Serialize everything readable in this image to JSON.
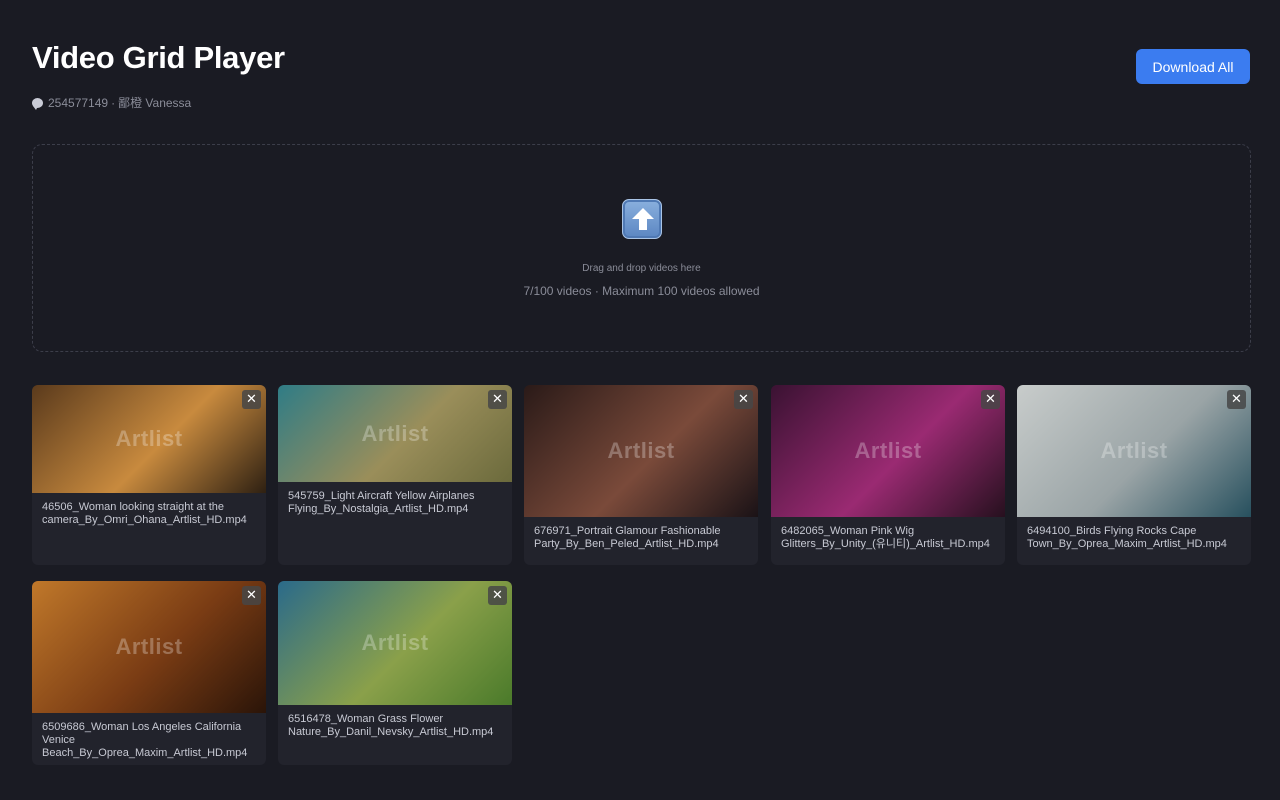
{
  "header": {
    "title": "Video Grid Player",
    "subtitle_id": "254577149",
    "subtitle_sep": "·",
    "subtitle_name": "鄙橙 Vanessa",
    "download_label": "Download All"
  },
  "dropzone": {
    "icon": "upload-arrow-icon",
    "text": "Drag and drop videos here",
    "count": "7/100 videos · Maximum 100 videos allowed"
  },
  "videos": [
    {
      "name": "46506_Woman looking straight at the camera_By_Omri_Ohana_Artlist_HD.mp4",
      "watermark": "Artlist",
      "close": "✕",
      "colors": [
        "#5a3a1c",
        "#c88a3e",
        "#2e2012"
      ]
    },
    {
      "name": "545759_Light Aircraft Yellow Airplanes Flying_By_Nostalgia_Artlist_HD.mp4",
      "watermark": "Artlist",
      "close": "✕",
      "colors": [
        "#2f7c86",
        "#9a8e5a",
        "#6b6a3c"
      ]
    },
    {
      "name": "676971_Portrait Glamour Fashionable Party_By_Ben_Peled_Artlist_HD.mp4",
      "watermark": "Artlist",
      "close": "✕",
      "colors": [
        "#2a1a18",
        "#7a4a3a",
        "#1a1216"
      ]
    },
    {
      "name": "6482065_Woman Pink Wig Glitters_By_Unity_(유니티)_Artlist_HD.mp4",
      "watermark": "Artlist",
      "close": "✕",
      "colors": [
        "#3a1232",
        "#9a2a72",
        "#26101e"
      ]
    },
    {
      "name": "6494100_Birds Flying Rocks Cape Town_By_Oprea_Maxim_Artlist_HD.mp4",
      "watermark": "Artlist",
      "close": "✕",
      "colors": [
        "#c8cccb",
        "#9aa4a6",
        "#27505e"
      ]
    },
    {
      "name": "6509686_Woman Los Angeles California Venice Beach_By_Oprea_Maxim_Artlist_HD.mp4",
      "watermark": "Artlist",
      "close": "✕",
      "colors": [
        "#c0782a",
        "#7a3c14",
        "#2a1408"
      ]
    },
    {
      "name": "6516478_Woman Grass Flower Nature_By_Danil_Nevsky_Artlist_HD.mp4",
      "watermark": "Artlist",
      "close": "✕",
      "colors": [
        "#2a6a8a",
        "#8aa04a",
        "#4a7a2a"
      ]
    }
  ]
}
